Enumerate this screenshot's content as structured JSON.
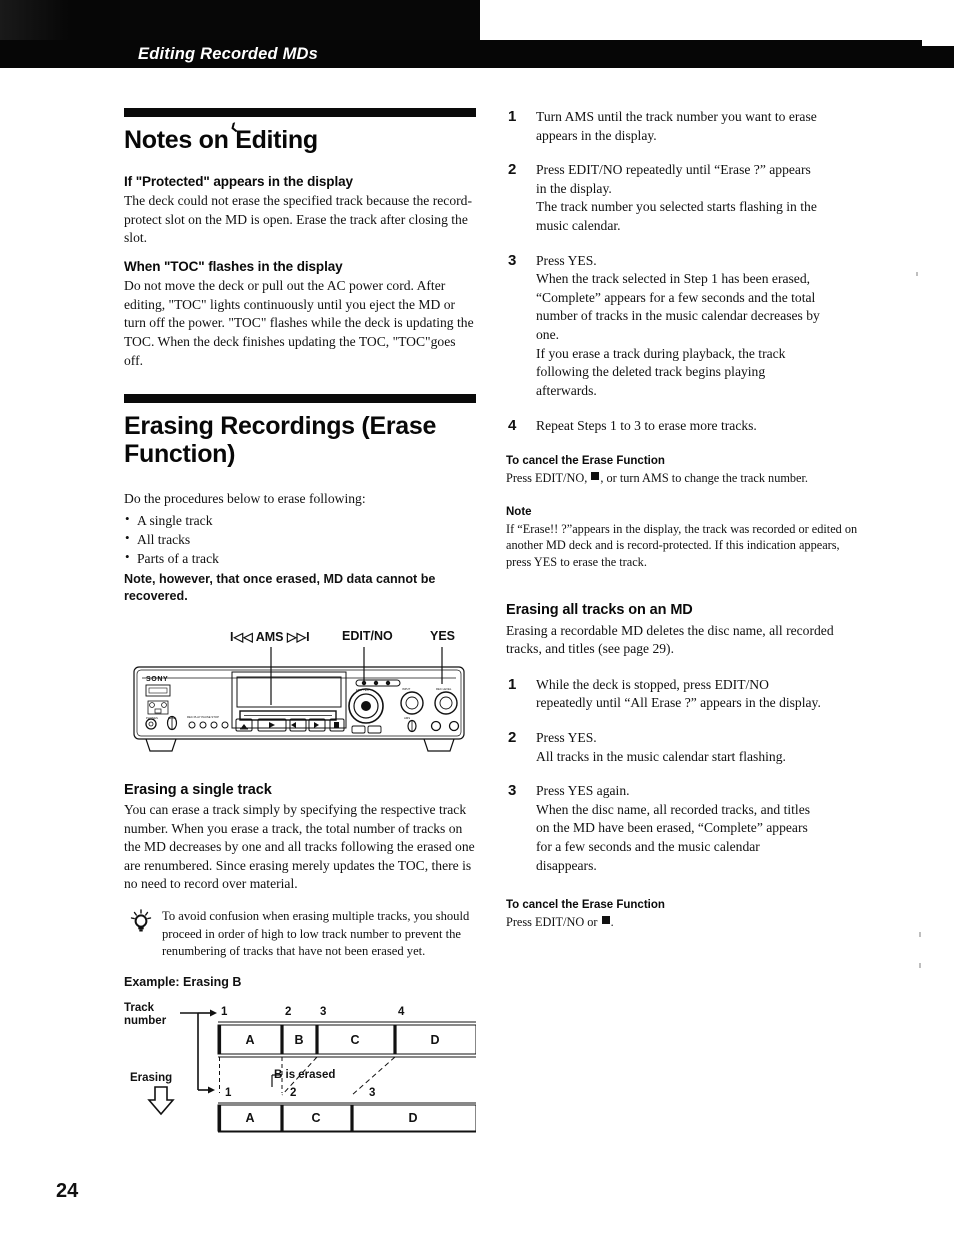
{
  "header": {
    "running_title": "Editing Recorded MDs"
  },
  "page": {
    "number": "24"
  },
  "left": {
    "section1": {
      "title": "Notes on Editing",
      "blocks": [
        {
          "heading": "If \"Protected\" appears in the display",
          "text": "The deck could not erase the specified track because the record-protect slot on the MD is open.  Erase the track after closing the slot."
        },
        {
          "heading": "When \"TOC\" flashes in the display",
          "text": "Do not move the deck or pull out the AC power cord.  After editing, \"TOC\" lights continuously until you eject the MD or turn off the power.  \"TOC\" flashes while the deck is updating the TOC.  When the deck finishes updating the TOC, \"TOC\"goes off."
        }
      ]
    },
    "section2": {
      "title_line1": "Erasing Recordings (Erase",
      "title_line2": "Function)",
      "intro": "Do the procedures below to erase following:",
      "bullets": [
        "A single track",
        "All tracks",
        "Parts of a track"
      ],
      "note_bold": "Note, however, that once erased, MD data cannot be recovered."
    },
    "deck_figure": {
      "callouts": [
        {
          "label": "I◁◁ AMS ▷▷I",
          "name": "ams-callout"
        },
        {
          "label": "EDIT/NO",
          "name": "edit-no-callout"
        },
        {
          "label": "YES",
          "name": "yes-callout"
        }
      ],
      "brand": "SONY"
    },
    "section3": {
      "heading": "Erasing a single track",
      "text": "You can erase a track simply by specifying the respective track number.  When you erase a track, the total number of tracks on the MD decreases by one and all tracks following the erased one are renumbered.  Since erasing merely updates the TOC, there is no need to record over material.",
      "tip": "To avoid confusion when erasing multiple tracks, you should proceed in order of high to low track number to prevent the renumbering of tracks that have not been erased yet."
    },
    "example": {
      "title": "Example:  Erasing B",
      "axis_label_line1": "Track",
      "axis_label_line2": "number",
      "erasing_label": "Erasing",
      "b_erased_label": "B is erased",
      "before": {
        "numbers": [
          "1",
          "2",
          "3",
          "4"
        ],
        "tracks": [
          "A",
          "B",
          "C",
          "D"
        ]
      },
      "after": {
        "numbers": [
          "1",
          "2",
          "3"
        ],
        "tracks": [
          "A",
          "C",
          "D"
        ]
      }
    }
  },
  "right": {
    "erase_steps": [
      {
        "num": "1",
        "lines": [
          "Turn AMS until the track number you want to erase",
          "appears in the display."
        ]
      },
      {
        "num": "2",
        "lines": [
          "Press EDIT/NO repeatedly until “Erase ?” appears",
          "in the display.",
          "The track number you selected starts flashing in the",
          "music calendar."
        ]
      },
      {
        "num": "3",
        "lines": [
          "Press YES.",
          "When the track selected in Step 1 has been erased,",
          "“Complete” appears for a few seconds and the total",
          "number of tracks in the music calendar decreases by",
          "one.",
          "If you erase a track during playback, the track",
          "following the deleted track begins playing",
          "afterwards."
        ]
      },
      {
        "num": "4",
        "lines": [
          "Repeat Steps 1 to 3 to erase more tracks."
        ]
      }
    ],
    "cancel1": {
      "heading": "To cancel the Erase Function",
      "text_before": "Press EDIT/NO, ",
      "text_after": ", or turn AMS to change the track number."
    },
    "note": {
      "heading": "Note",
      "text": "If “Erase!! ?”appears in the display, the track was recorded or edited on another MD deck and is record-protected.  If this indication appears, press YES to erase the track."
    },
    "all_tracks": {
      "heading": "Erasing all tracks on an MD",
      "intro": "Erasing a recordable MD deletes the disc name, all recorded tracks, and titles (see page 29).",
      "steps": [
        {
          "num": "1",
          "lines": [
            "While the deck is stopped, press EDIT/NO",
            "repeatedly until “All Erase ?” appears in the display."
          ]
        },
        {
          "num": "2",
          "lines": [
            "Press YES.",
            "All tracks in the music calendar start flashing."
          ]
        },
        {
          "num": "3",
          "lines": [
            "Press YES again.",
            "When the disc name, all recorded tracks, and titles",
            "on the MD have been erased, “Complete” appears",
            "for a few seconds and the music calendar",
            "disappears."
          ]
        }
      ]
    },
    "cancel2": {
      "heading": "To cancel the Erase Function",
      "text_before": "Press EDIT/NO or ",
      "text_after": "."
    }
  }
}
